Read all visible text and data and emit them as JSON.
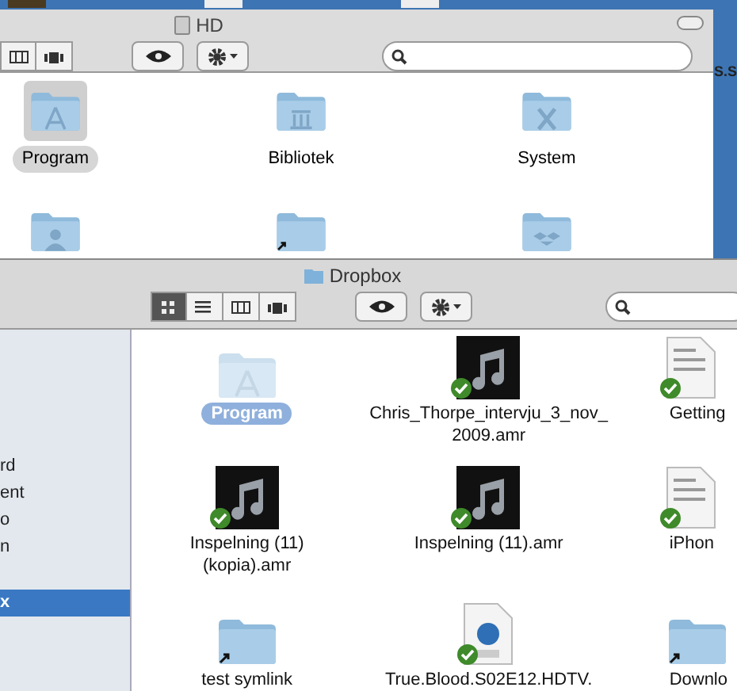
{
  "desktop": {
    "edge_text": "S.S"
  },
  "hd_window": {
    "title": "HD",
    "view_modes": [
      {
        "kind": "columns",
        "selected": false
      },
      {
        "kind": "coverflow",
        "selected": false
      }
    ],
    "items": [
      {
        "name": "Program",
        "kind": "applications",
        "selected": true
      },
      {
        "name": "Bibliotek",
        "kind": "library",
        "selected": false
      },
      {
        "name": "System",
        "kind": "system",
        "selected": false
      },
      {
        "kind": "users"
      },
      {
        "kind": "alias"
      },
      {
        "kind": "dropbox"
      }
    ]
  },
  "dropbox_window": {
    "title": "Dropbox",
    "view_modes": [
      {
        "kind": "icons",
        "selected": true
      },
      {
        "kind": "list",
        "selected": false
      },
      {
        "kind": "columns",
        "selected": false
      },
      {
        "kind": "coverflow",
        "selected": false
      }
    ],
    "sidebar": {
      "items": [
        {
          "label": "rd",
          "selected": false
        },
        {
          "label": "ent",
          "selected": false
        },
        {
          "label": "o",
          "selected": false
        },
        {
          "label": "n",
          "selected": false
        },
        {
          "label": "x",
          "selected": true
        }
      ]
    },
    "items": [
      {
        "name": "Program",
        "kind": "applications",
        "selected": true,
        "synced": false
      },
      {
        "name": "Chris_Thorpe_intervju_3_nov_2009.amr",
        "kind": "music",
        "selected": false,
        "synced": true
      },
      {
        "name": "Getting",
        "kind": "document",
        "selected": false,
        "synced": true
      },
      {
        "name": "Inspelning (11) (kopia).amr",
        "kind": "music",
        "selected": false,
        "synced": true
      },
      {
        "name": "Inspelning (11).amr",
        "kind": "music",
        "selected": false,
        "synced": true
      },
      {
        "name": "iPhon",
        "kind": "document",
        "selected": false,
        "synced": true
      },
      {
        "name": "test symlink",
        "kind": "alias",
        "selected": false,
        "synced": false
      },
      {
        "name": "True.Blood.S02E12.HDTV.",
        "kind": "video",
        "selected": false,
        "synced": true
      },
      {
        "name": "Downlo",
        "kind": "alias",
        "selected": false,
        "synced": false
      }
    ]
  }
}
